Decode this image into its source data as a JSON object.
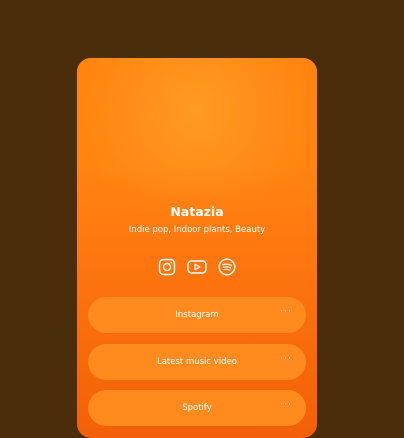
{
  "profile": {
    "name": "Natazia",
    "tagline": "Indie pop, Indoor plants, Beauty"
  },
  "socials": [
    {
      "icon": "instagram-icon"
    },
    {
      "icon": "youtube-icon"
    },
    {
      "icon": "spotify-icon"
    }
  ],
  "links": [
    {
      "label": "Instagram",
      "more": "···"
    },
    {
      "label": "Latest music video",
      "more": "···"
    },
    {
      "label": "Spotify",
      "more": "···"
    }
  ],
  "colors": {
    "page_background": "#4a2e0c",
    "card_top": "#ff8a12",
    "card_bottom": "#f25f08",
    "link_button": "#ff8a1e"
  }
}
